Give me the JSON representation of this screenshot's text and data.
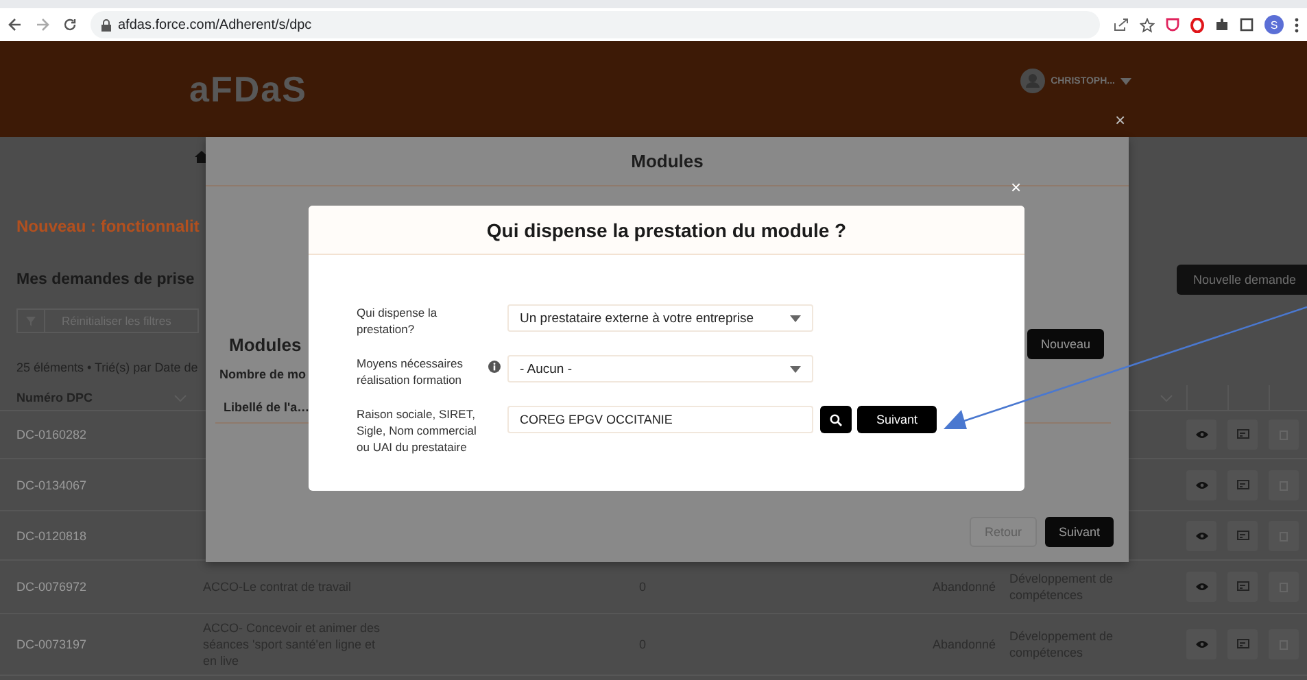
{
  "browser": {
    "url": "afdas.force.com/Adherent/s/dpc",
    "profile_initial": "S"
  },
  "header": {
    "logo": "aFDaS",
    "user": "CHRISTOPH..."
  },
  "page": {
    "notice": "Nouveau : fonctionnalit",
    "title": "Mes demandes de prise",
    "new_request_button": "Nouvelle demande",
    "filter_button": "Réinitialiser les filtres",
    "summary": "25 éléments • Trié(s) par Date de",
    "table": {
      "columns": [
        "Numéro DPC"
      ],
      "rows": [
        {
          "cells": [
            "DC-0160282"
          ]
        },
        {
          "cells": [
            "DC-0134067"
          ]
        },
        {
          "cells": [
            "DC-0120818"
          ]
        },
        {
          "cells": [
            "DC-0076972",
            "ACCO-Le contrat de travail",
            "0",
            "Abandonné",
            "Développement de compétences"
          ]
        },
        {
          "cells": [
            "DC-0073197",
            "ACCO- Concevoir et animer des séances 'sport santé'en ligne et en live",
            "0",
            "Abandonné",
            "Développement de compétences"
          ]
        }
      ]
    }
  },
  "modules_dialog": {
    "title": "Modules",
    "close": "×",
    "section_title": "Modules",
    "new_button": "Nouveau",
    "count_label": "Nombre de mo",
    "table_column": "Libellé de l'a…",
    "back_button": "Retour",
    "next_button": "Suivant"
  },
  "provider_dialog": {
    "title": "Qui dispense la prestation du module ?",
    "close": "×",
    "fields": [
      {
        "kind": "select",
        "label": "Qui dispense la prestation?",
        "value": "Un prestataire externe à votre entreprise",
        "info": false
      },
      {
        "kind": "select",
        "label": "Moyens nécessaires réalisation formation",
        "value": "- Aucun -",
        "info": true
      },
      {
        "kind": "search",
        "label": "Raison sociale, SIRET, Sigle, Nom commercial ou UAI du prestataire",
        "value": "COREG EPGV OCCITANIE",
        "button": "Suivant",
        "info": false
      }
    ]
  }
}
